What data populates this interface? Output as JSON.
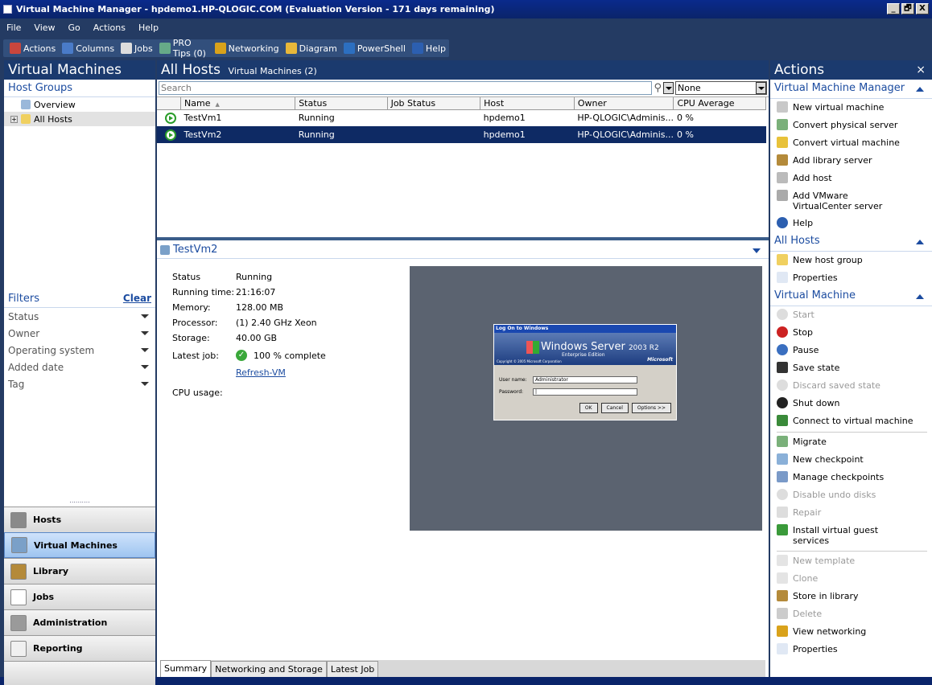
{
  "window": {
    "title": "Virtual Machine Manager - hpdemo1.HP-QLOGIC.COM (Evaluation Version - 171 days remaining)",
    "controls": [
      "_",
      "🗗",
      "X"
    ]
  },
  "menu": [
    "File",
    "View",
    "Go",
    "Actions",
    "Help"
  ],
  "toolbar": [
    {
      "label": "Actions",
      "icon": "actions-icon",
      "color": "#c9463d"
    },
    {
      "label": "Columns",
      "icon": "columns-icon",
      "color": "#4a7bc8"
    },
    {
      "label": "Jobs",
      "icon": "jobs-icon",
      "color": "#ddd"
    },
    {
      "label": "PRO Tips (0)",
      "icon": "pro-tips-icon",
      "color": "#6a8"
    },
    {
      "label": "Networking",
      "icon": "networking-icon",
      "color": "#d9a21b"
    },
    {
      "label": "Diagram",
      "icon": "diagram-icon",
      "color": "#e8b83a"
    },
    {
      "label": "PowerShell",
      "icon": "powershell-icon",
      "color": "#2c6fc0"
    },
    {
      "label": "Help",
      "icon": "help-icon",
      "color": "#2c5fb0"
    }
  ],
  "left": {
    "title": "Virtual Machines",
    "host_groups_label": "Host Groups",
    "tree": [
      {
        "label": "Overview",
        "expander": ""
      },
      {
        "label": "All Hosts",
        "expander": "+"
      }
    ],
    "filters_label": "Filters",
    "clear_label": "Clear",
    "filters": [
      "Status",
      "Owner",
      "Operating system",
      "Added date",
      "Tag"
    ],
    "grip": "..........",
    "wunderbar": [
      {
        "label": "Hosts",
        "icon": "hosts-icon",
        "color": "#8a8a8a",
        "selected": false
      },
      {
        "label": "Virtual Machines",
        "icon": "virtual-machines-icon",
        "color": "#7aa0c8",
        "selected": true
      },
      {
        "label": "Library",
        "icon": "library-icon",
        "color": "#b48a3a",
        "selected": false
      },
      {
        "label": "Jobs",
        "icon": "jobs-icon",
        "color": "#ffffff",
        "selected": false
      },
      {
        "label": "Administration",
        "icon": "administration-icon",
        "color": "#9a9a9a",
        "selected": false
      },
      {
        "label": "Reporting",
        "icon": "reporting-icon",
        "color": "#f0f0f0",
        "selected": false
      }
    ]
  },
  "center": {
    "title": "All Hosts",
    "subtitle": "Virtual Machines (2)",
    "search_placeholder": "Search",
    "filter_value": "None",
    "columns": [
      "Name",
      "Status",
      "Job Status",
      "Host",
      "Owner",
      "CPU Average"
    ],
    "sort_indicator": "▲",
    "rows": [
      {
        "name": "TestVm1",
        "status": "Running",
        "job_status": "",
        "host": "hpdemo1",
        "owner": "HP-QLOGIC\\Adminis...",
        "cpu": "0 %",
        "selected": false
      },
      {
        "name": "TestVm2",
        "status": "Running",
        "job_status": "",
        "host": "hpdemo1",
        "owner": "HP-QLOGIC\\Adminis...",
        "cpu": "0 %",
        "selected": true
      }
    ],
    "detail": {
      "title": "TestVm2",
      "props": [
        {
          "k": "Status",
          "v": "Running"
        },
        {
          "k": "Running time:",
          "v": "21:16:07"
        },
        {
          "k": "Memory:",
          "v": "128.00 MB"
        },
        {
          "k": "Processor:",
          "v": "(1) 2.40 GHz Xeon"
        },
        {
          "k": "Storage:",
          "v": "40.00 GB"
        }
      ],
      "latest_job_label": "Latest job:",
      "latest_job_value": "100 % complete",
      "refresh_link": "Refresh-VM",
      "cpu_usage_label": "CPU usage:"
    },
    "thumbnail": {
      "window_title": "Log On to Windows",
      "product": "Windows Server",
      "version": "2003 R2",
      "edition": "Enterprise Edition",
      "brand": "Microsoft",
      "copyright": "Copyright © 2005 Microsoft Corporation",
      "user_label": "User name:",
      "user_value": "Administrator",
      "password_label": "Password:",
      "buttons": [
        "OK",
        "Cancel",
        "Options >>"
      ]
    },
    "tabs": [
      "Summary",
      "Networking and Storage",
      "Latest Job"
    ]
  },
  "actions": {
    "title": "Actions",
    "close": "×",
    "groups": [
      {
        "label": "Virtual Machine Manager",
        "items": [
          {
            "label": "New virtual machine",
            "icon": "new-vm-icon",
            "color": "#c8c8c8",
            "disabled": false
          },
          {
            "label": "Convert physical server",
            "icon": "convert-physical-icon",
            "color": "#7ab07a",
            "disabled": false
          },
          {
            "label": "Convert virtual machine",
            "icon": "convert-virtual-icon",
            "color": "#e8c23a",
            "disabled": false
          },
          {
            "label": "Add library server",
            "icon": "add-library-icon",
            "color": "#b48a3a",
            "disabled": false
          },
          {
            "label": "Add host",
            "icon": "add-host-icon",
            "color": "#bbbbbb",
            "disabled": false
          },
          {
            "label": "Add VMware VirtualCenter server",
            "icon": "add-vmware-icon",
            "color": "#aaaaaa",
            "disabled": false
          },
          {
            "label": "Help",
            "icon": "help-icon",
            "color": "#2c5fb0",
            "disabled": false
          }
        ]
      },
      {
        "label": "All Hosts",
        "items": [
          {
            "label": "New host group",
            "icon": "folder-icon",
            "color": "#f0d060",
            "disabled": false
          },
          {
            "label": "Properties",
            "icon": "properties-icon",
            "color": "#e0e8f4",
            "disabled": false
          }
        ]
      },
      {
        "label": "Virtual Machine",
        "items": [
          {
            "label": "Start",
            "icon": "start-icon",
            "color": "#dddddd",
            "disabled": true
          },
          {
            "label": "Stop",
            "icon": "stop-icon",
            "color": "#cc2222",
            "disabled": false
          },
          {
            "label": "Pause",
            "icon": "pause-icon",
            "color": "#3a6fc0",
            "disabled": false
          },
          {
            "label": "Save state",
            "icon": "save-state-icon",
            "color": "#333333",
            "disabled": false
          },
          {
            "label": "Discard saved state",
            "icon": "discard-icon",
            "color": "#dddddd",
            "disabled": true
          },
          {
            "label": "Shut down",
            "icon": "shutdown-icon",
            "color": "#222222",
            "disabled": false
          },
          {
            "label": "Connect to virtual machine",
            "icon": "connect-icon",
            "color": "#3a8a3a",
            "disabled": false
          },
          {
            "sep": true
          },
          {
            "label": "Migrate",
            "icon": "migrate-icon",
            "color": "#7ab07a",
            "disabled": false
          },
          {
            "label": "New checkpoint",
            "icon": "new-checkpoint-icon",
            "color": "#8ab0d8",
            "disabled": false
          },
          {
            "label": "Manage checkpoints",
            "icon": "manage-checkpoints-icon",
            "color": "#7a9ac8",
            "disabled": false
          },
          {
            "label": "Disable undo disks",
            "icon": "undo-disks-icon",
            "color": "#dddddd",
            "disabled": true
          },
          {
            "label": "Repair",
            "icon": "repair-icon",
            "color": "#dddddd",
            "disabled": true
          },
          {
            "label": "Install virtual guest services",
            "icon": "install-services-icon",
            "color": "#3a9a3a",
            "disabled": false
          },
          {
            "sep": true
          },
          {
            "label": "New template",
            "icon": "new-template-icon",
            "color": "#e4e4e4",
            "disabled": true
          },
          {
            "label": "Clone",
            "icon": "clone-icon",
            "color": "#e4e4e4",
            "disabled": true
          },
          {
            "label": "Store in library",
            "icon": "store-library-icon",
            "color": "#b48a3a",
            "disabled": false
          },
          {
            "label": "Delete",
            "icon": "delete-icon",
            "color": "#cccccc",
            "disabled": true
          },
          {
            "label": "View networking",
            "icon": "view-networking-icon",
            "color": "#d9a21b",
            "disabled": false
          },
          {
            "label": "Properties",
            "icon": "properties-icon",
            "color": "#e0e8f4",
            "disabled": false
          }
        ]
      }
    ]
  }
}
